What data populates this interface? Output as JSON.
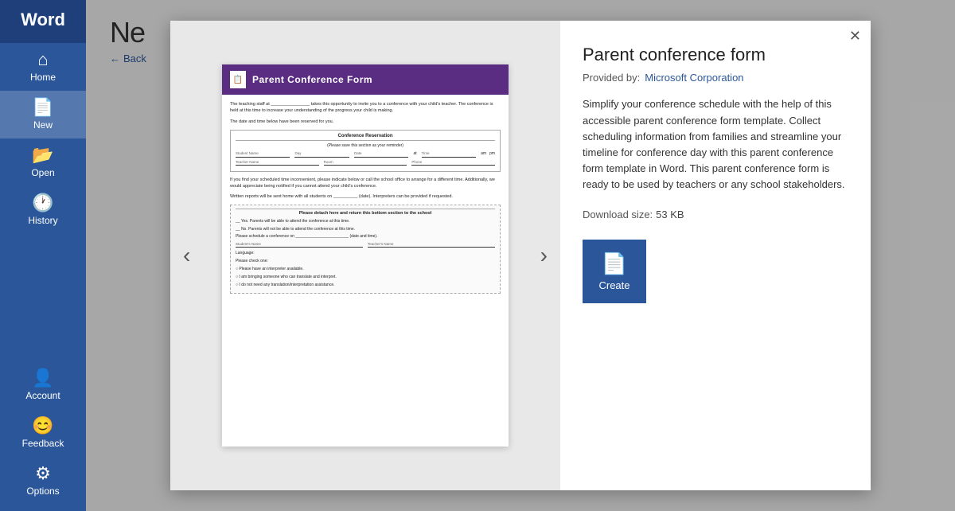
{
  "app": {
    "name": "Word"
  },
  "sidebar": {
    "items": [
      {
        "id": "home",
        "label": "Home",
        "icon": "⌂",
        "active": false
      },
      {
        "id": "new",
        "label": "New",
        "icon": "📄",
        "active": true
      },
      {
        "id": "open",
        "label": "Open",
        "icon": "📂",
        "active": false
      },
      {
        "id": "history",
        "label": "History",
        "icon": "",
        "active": false
      }
    ],
    "bottom_items": [
      {
        "id": "account",
        "label": "Account",
        "icon": ""
      },
      {
        "id": "feedback",
        "label": "Feedback",
        "icon": ""
      },
      {
        "id": "options",
        "label": "Options",
        "icon": ""
      }
    ]
  },
  "main": {
    "title": "Ne",
    "back_label": "Back"
  },
  "modal": {
    "close_label": "✕",
    "template": {
      "title": "Parent conference form",
      "provider_label": "Provided by:",
      "provider_name": "Microsoft Corporation",
      "description": "Simplify your conference schedule with the help of this accessible parent conference form template. Collect scheduling information from families and streamline your timeline for conference day with this parent conference form template in Word. This parent conference form is ready to be used by teachers or any school stakeholders.",
      "download_label": "Download size:",
      "download_size": "53 KB",
      "create_label": "Create"
    },
    "doc": {
      "header_title": "Parent Conference Form",
      "body_text1": "The teaching staff at ________________ takes this opportunity to invite you to a conference with your child's teacher. The conference is held at this time to increase your understanding of the progress your child is making.",
      "body_text2": "The date and time below have been reserved for you.",
      "section_title": "Conference Reservation",
      "section_subtitle": "(Please save this section as your reminder)",
      "at_label": "at",
      "student_label": "Student Name",
      "day_label": "Day",
      "date_label": "Date",
      "time_label": "Time",
      "am_label": "am",
      "pm_label": "pm",
      "teacher_label": "Teacher Name",
      "room_label": "Room",
      "phone_label": "Phone",
      "body_text3": "If you find your scheduled time inconvenient, please indicate below or call the school office to arrange for a different time. Additionally, we would appreciate being notified if you cannot attend your child's conference.",
      "body_text4": "Written reports will be sent home with all students on __________ (date). Interpreters can be provided if requested.",
      "detach_label": "Please detach here and return this bottom section to the school",
      "yes_text": "__ Yes. Parents will be able to attend the conference at this time.",
      "no_text": "__ No. Parents will not be able to attend the conference at this time.",
      "schedule_text": "Please schedule a conference on ________________________ (date and time).",
      "student_name_label": "Student's Name",
      "teacher_name_label": "Teacher's Name",
      "language_label": "Language:",
      "check_label": "Please check one:",
      "opt1": "Please have an interpreter available.",
      "opt2": "I am bringing someone who can translate and interpret.",
      "opt3": "I do not need any translation/interpretation assistance."
    },
    "prev_label": "‹",
    "next_label": "›"
  }
}
